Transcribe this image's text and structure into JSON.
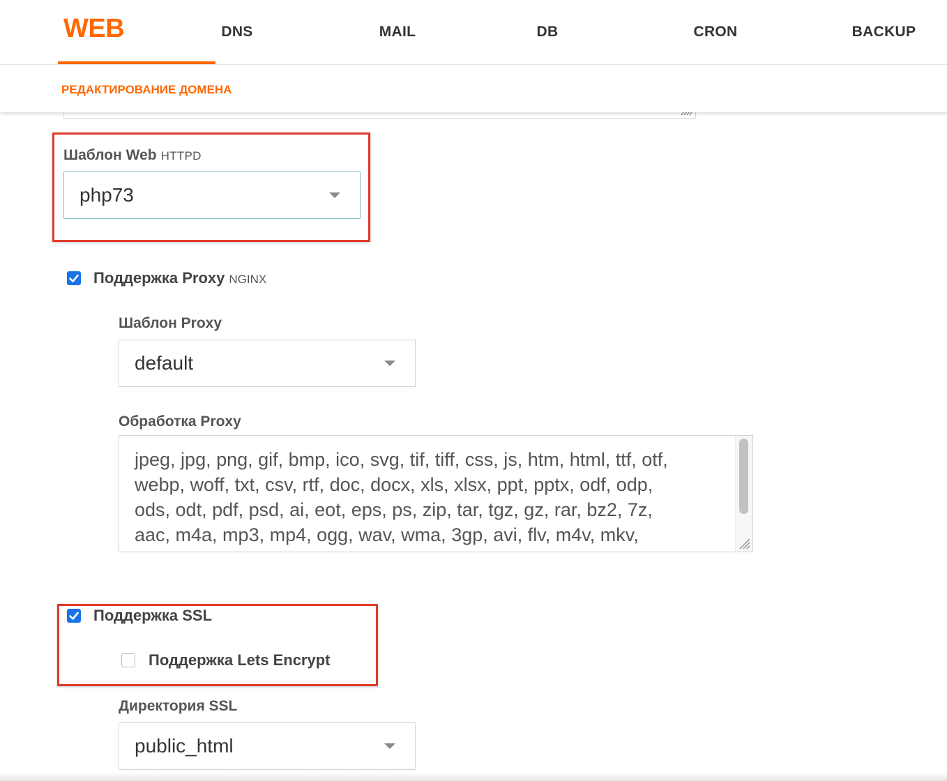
{
  "nav": {
    "tabs": [
      {
        "label": "WEB",
        "active": true
      },
      {
        "label": "DNS"
      },
      {
        "label": "MAIL"
      },
      {
        "label": "DB"
      },
      {
        "label": "CRON"
      },
      {
        "label": "BACKUP"
      }
    ]
  },
  "subheader": {
    "title": "РЕДАКТИРОВАНИЕ ДОМЕНА"
  },
  "web_template": {
    "label": "Шаблон Web",
    "hint": "HTTPD",
    "value": "php73"
  },
  "proxy_support": {
    "label": "Поддержка Proxy",
    "hint": "NGINX",
    "checked": true
  },
  "proxy_template": {
    "label": "Шаблон Proxy",
    "value": "default"
  },
  "proxy_extensions": {
    "label": "Обработка Proxy",
    "lines": [
      "jpeg, jpg, png, gif, bmp, ico, svg, tif, tiff, css, js, htm, html, ttf, otf,",
      "webp, woff, txt, csv, rtf, doc, docx, xls, xlsx, ppt, pptx, odf, odp,",
      "ods, odt, pdf, psd, ai, eot, eps, ps, zip, tar, tgz, gz, rar, bz2, 7z,",
      "aac, m4a, mp3, mp4, ogg, wav, wma, 3gp, avi, flv, m4v, mkv,"
    ]
  },
  "ssl_support": {
    "label": "Поддержка SSL",
    "checked": true
  },
  "lets_encrypt": {
    "label": "Поддержка Lets Encrypt",
    "checked": false
  },
  "ssl_directory": {
    "label": "Директория SSL",
    "value": "public_html"
  },
  "colors": {
    "accent": "#ff6701",
    "highlight": "#e03a2a",
    "checkbox": "#1a73e8",
    "focus_border": "#74c0c4"
  }
}
